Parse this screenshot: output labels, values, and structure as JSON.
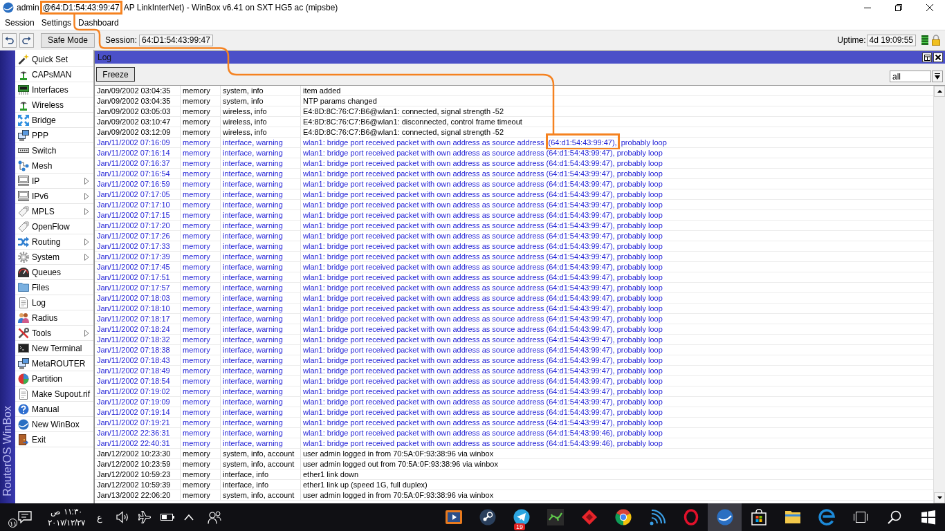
{
  "window": {
    "title_parts": [
      {
        "text": "admin",
        "highlighted": false
      },
      {
        "text": "@64:D1:54:43:99:47",
        "highlighted": true
      },
      {
        "text": "AP LinkInterNet) - WinBox v6.41 on SXT HG5 ac (mipsbe)",
        "highlighted": false
      }
    ]
  },
  "menu": [
    "Session",
    "Settings",
    "Dashboard"
  ],
  "toolbar": {
    "safe_mode": "Safe Mode",
    "session_label": "Session:",
    "session_value": "64:D1:54:43:99:47",
    "uptime_label": "Uptime:",
    "uptime_value": "4d 19:09:55"
  },
  "sidebar": {
    "brand": "RouterOS WinBox",
    "items": [
      {
        "label": "Quick Set",
        "submenu": false
      },
      {
        "label": "CAPsMAN",
        "submenu": false
      },
      {
        "label": "Interfaces",
        "submenu": false
      },
      {
        "label": "Wireless",
        "submenu": false
      },
      {
        "label": "Bridge",
        "submenu": false
      },
      {
        "label": "PPP",
        "submenu": false
      },
      {
        "label": "Switch",
        "submenu": false
      },
      {
        "label": "Mesh",
        "submenu": false
      },
      {
        "label": "IP",
        "submenu": true
      },
      {
        "label": "IPv6",
        "submenu": true
      },
      {
        "label": "MPLS",
        "submenu": true
      },
      {
        "label": "OpenFlow",
        "submenu": false
      },
      {
        "label": "Routing",
        "submenu": true
      },
      {
        "label": "System",
        "submenu": true
      },
      {
        "label": "Queues",
        "submenu": false
      },
      {
        "label": "Files",
        "submenu": false
      },
      {
        "label": "Log",
        "submenu": false
      },
      {
        "label": "Radius",
        "submenu": false
      },
      {
        "label": "Tools",
        "submenu": true
      },
      {
        "label": "New Terminal",
        "submenu": false
      },
      {
        "label": "MetaROUTER",
        "submenu": false
      },
      {
        "label": "Partition",
        "submenu": false
      },
      {
        "label": "Make Supout.rif",
        "submenu": false
      },
      {
        "label": "Manual",
        "submenu": false
      },
      {
        "label": "New WinBox",
        "submenu": false
      },
      {
        "label": "Exit",
        "submenu": false
      }
    ]
  },
  "log": {
    "title": "Log",
    "freeze": "Freeze",
    "filter": "all",
    "rows": [
      {
        "time": "Jan/09/2002 03:04:35",
        "buffer": "memory",
        "topics": "system, info",
        "message": "item added",
        "kind": "info"
      },
      {
        "time": "Jan/09/2002 03:04:35",
        "buffer": "memory",
        "topics": "system, info",
        "message": "NTP params changed",
        "kind": "info"
      },
      {
        "time": "Jan/09/2002 03:05:03",
        "buffer": "memory",
        "topics": "wireless, info",
        "message": "E4:8D:8C:76:C7:B6@wlan1: connected, signal strength -52",
        "kind": "info"
      },
      {
        "time": "Jan/09/2002 03:10:47",
        "buffer": "memory",
        "topics": "wireless, info",
        "message": "E4:8D:8C:76:C7:B6@wlan1: disconnected, control frame timeout",
        "kind": "info"
      },
      {
        "time": "Jan/09/2002 03:12:09",
        "buffer": "memory",
        "topics": "wireless, info",
        "message": "E4:8D:8C:76:C7:B6@wlan1: connected, signal strength -52",
        "kind": "info"
      },
      {
        "time": "Jan/11/2002 07:16:09",
        "buffer": "memory",
        "topics": "interface, warning",
        "message": "wlan1: bridge port received packet with own address as source address",
        "highlight": "(64:d1:54:43:99:47),",
        "message_end": "probably loop",
        "kind": "warning"
      },
      {
        "time": "Jan/11/2002 07:16:14",
        "buffer": "memory",
        "topics": "interface, warning",
        "message": "wlan1: bridge port received packet with own address as source address (64:d1:54:43:99:47), probably loop",
        "kind": "warning"
      },
      {
        "time": "Jan/11/2002 07:16:37",
        "buffer": "memory",
        "topics": "interface, warning",
        "message": "wlan1: bridge port received packet with own address as source address (64:d1:54:43:99:47), probably loop",
        "kind": "warning"
      },
      {
        "time": "Jan/11/2002 07:16:54",
        "buffer": "memory",
        "topics": "interface, warning",
        "message": "wlan1: bridge port received packet with own address as source address (64:d1:54:43:99:47), probably loop",
        "kind": "warning"
      },
      {
        "time": "Jan/11/2002 07:16:59",
        "buffer": "memory",
        "topics": "interface, warning",
        "message": "wlan1: bridge port received packet with own address as source address (64:d1:54:43:99:47), probably loop",
        "kind": "warning"
      },
      {
        "time": "Jan/11/2002 07:17:05",
        "buffer": "memory",
        "topics": "interface, warning",
        "message": "wlan1: bridge port received packet with own address as source address (64:d1:54:43:99:47), probably loop",
        "kind": "warning"
      },
      {
        "time": "Jan/11/2002 07:17:10",
        "buffer": "memory",
        "topics": "interface, warning",
        "message": "wlan1: bridge port received packet with own address as source address (64:d1:54:43:99:47), probably loop",
        "kind": "warning"
      },
      {
        "time": "Jan/11/2002 07:17:15",
        "buffer": "memory",
        "topics": "interface, warning",
        "message": "wlan1: bridge port received packet with own address as source address (64:d1:54:43:99:47), probably loop",
        "kind": "warning"
      },
      {
        "time": "Jan/11/2002 07:17:20",
        "buffer": "memory",
        "topics": "interface, warning",
        "message": "wlan1: bridge port received packet with own address as source address (64:d1:54:43:99:47), probably loop",
        "kind": "warning"
      },
      {
        "time": "Jan/11/2002 07:17:26",
        "buffer": "memory",
        "topics": "interface, warning",
        "message": "wlan1: bridge port received packet with own address as source address (64:d1:54:43:99:47), probably loop",
        "kind": "warning"
      },
      {
        "time": "Jan/11/2002 07:17:33",
        "buffer": "memory",
        "topics": "interface, warning",
        "message": "wlan1: bridge port received packet with own address as source address (64:d1:54:43:99:47), probably loop",
        "kind": "warning"
      },
      {
        "time": "Jan/11/2002 07:17:39",
        "buffer": "memory",
        "topics": "interface, warning",
        "message": "wlan1: bridge port received packet with own address as source address (64:d1:54:43:99:47), probably loop",
        "kind": "warning"
      },
      {
        "time": "Jan/11/2002 07:17:45",
        "buffer": "memory",
        "topics": "interface, warning",
        "message": "wlan1: bridge port received packet with own address as source address (64:d1:54:43:99:47), probably loop",
        "kind": "warning"
      },
      {
        "time": "Jan/11/2002 07:17:51",
        "buffer": "memory",
        "topics": "interface, warning",
        "message": "wlan1: bridge port received packet with own address as source address (64:d1:54:43:99:47), probably loop",
        "kind": "warning"
      },
      {
        "time": "Jan/11/2002 07:17:57",
        "buffer": "memory",
        "topics": "interface, warning",
        "message": "wlan1: bridge port received packet with own address as source address (64:d1:54:43:99:47), probably loop",
        "kind": "warning"
      },
      {
        "time": "Jan/11/2002 07:18:03",
        "buffer": "memory",
        "topics": "interface, warning",
        "message": "wlan1: bridge port received packet with own address as source address (64:d1:54:43:99:47), probably loop",
        "kind": "warning"
      },
      {
        "time": "Jan/11/2002 07:18:10",
        "buffer": "memory",
        "topics": "interface, warning",
        "message": "wlan1: bridge port received packet with own address as source address (64:d1:54:43:99:47), probably loop",
        "kind": "warning"
      },
      {
        "time": "Jan/11/2002 07:18:17",
        "buffer": "memory",
        "topics": "interface, warning",
        "message": "wlan1: bridge port received packet with own address as source address (64:d1:54:43:99:47), probably loop",
        "kind": "warning"
      },
      {
        "time": "Jan/11/2002 07:18:24",
        "buffer": "memory",
        "topics": "interface, warning",
        "message": "wlan1: bridge port received packet with own address as source address (64:d1:54:43:99:47), probably loop",
        "kind": "warning"
      },
      {
        "time": "Jan/11/2002 07:18:32",
        "buffer": "memory",
        "topics": "interface, warning",
        "message": "wlan1: bridge port received packet with own address as source address (64:d1:54:43:99:47), probably loop",
        "kind": "warning"
      },
      {
        "time": "Jan/11/2002 07:18:38",
        "buffer": "memory",
        "topics": "interface, warning",
        "message": "wlan1: bridge port received packet with own address as source address (64:d1:54:43:99:47), probably loop",
        "kind": "warning"
      },
      {
        "time": "Jan/11/2002 07:18:43",
        "buffer": "memory",
        "topics": "interface, warning",
        "message": "wlan1: bridge port received packet with own address as source address (64:d1:54:43:99:47), probably loop",
        "kind": "warning"
      },
      {
        "time": "Jan/11/2002 07:18:49",
        "buffer": "memory",
        "topics": "interface, warning",
        "message": "wlan1: bridge port received packet with own address as source address (64:d1:54:43:99:47), probably loop",
        "kind": "warning"
      },
      {
        "time": "Jan/11/2002 07:18:54",
        "buffer": "memory",
        "topics": "interface, warning",
        "message": "wlan1: bridge port received packet with own address as source address (64:d1:54:43:99:47), probably loop",
        "kind": "warning"
      },
      {
        "time": "Jan/11/2002 07:19:02",
        "buffer": "memory",
        "topics": "interface, warning",
        "message": "wlan1: bridge port received packet with own address as source address (64:d1:54:43:99:47), probably loop",
        "kind": "warning"
      },
      {
        "time": "Jan/11/2002 07:19:09",
        "buffer": "memory",
        "topics": "interface, warning",
        "message": "wlan1: bridge port received packet with own address as source address (64:d1:54:43:99:47), probably loop",
        "kind": "warning"
      },
      {
        "time": "Jan/11/2002 07:19:14",
        "buffer": "memory",
        "topics": "interface, warning",
        "message": "wlan1: bridge port received packet with own address as source address (64:d1:54:43:99:47), probably loop",
        "kind": "warning"
      },
      {
        "time": "Jan/11/2002 07:19:21",
        "buffer": "memory",
        "topics": "interface, warning",
        "message": "wlan1: bridge port received packet with own address as source address (64:d1:54:43:99:47), probably loop",
        "kind": "warning"
      },
      {
        "time": "Jan/11/2002 22:36:31",
        "buffer": "memory",
        "topics": "interface, warning",
        "message": "wlan1: bridge port received packet with own address as source address (64:d1:54:43:99:46), probably loop",
        "kind": "warning"
      },
      {
        "time": "Jan/11/2002 22:40:31",
        "buffer": "memory",
        "topics": "interface, warning",
        "message": "wlan1: bridge port received packet with own address as source address (64:d1:54:43:99:46), probably loop",
        "kind": "warning"
      },
      {
        "time": "Jan/12/2002 10:23:30",
        "buffer": "memory",
        "topics": "system, info, account",
        "message": "user admin logged in from 70:5A:0F:93:38:96 via winbox",
        "kind": "info"
      },
      {
        "time": "Jan/12/2002 10:23:59",
        "buffer": "memory",
        "topics": "system, info, account",
        "message": "user admin logged out from 70:5A:0F:93:38:96 via winbox",
        "kind": "info"
      },
      {
        "time": "Jan/12/2002 10:59:23",
        "buffer": "memory",
        "topics": "interface, info",
        "message": "ether1 link down",
        "kind": "info"
      },
      {
        "time": "Jan/12/2002 10:59:39",
        "buffer": "memory",
        "topics": "interface, info",
        "message": "ether1 link up (speed 1G, full duplex)",
        "kind": "info"
      },
      {
        "time": "Jan/13/2002 22:06:20",
        "buffer": "memory",
        "topics": "system, info, account",
        "message": "user admin logged in from 70:5A:0F:93:38:96 via winbox",
        "kind": "info"
      }
    ]
  },
  "annotation_line": true,
  "taskbar": {
    "notification_count": "١١",
    "time": "١١:٣٠ ص",
    "date": "٢٠١٧/١٢/٢٧",
    "language": "ع",
    "apps": [
      {
        "active": false
      },
      {
        "active": false
      },
      {
        "active": false,
        "badge": "19"
      },
      {
        "active": false
      },
      {
        "active": false
      },
      {
        "active": false
      },
      {
        "active": false
      },
      {
        "active": false
      },
      {
        "active": true
      },
      {
        "active": false
      },
      {
        "active": false
      },
      {
        "active": false
      }
    ]
  }
}
